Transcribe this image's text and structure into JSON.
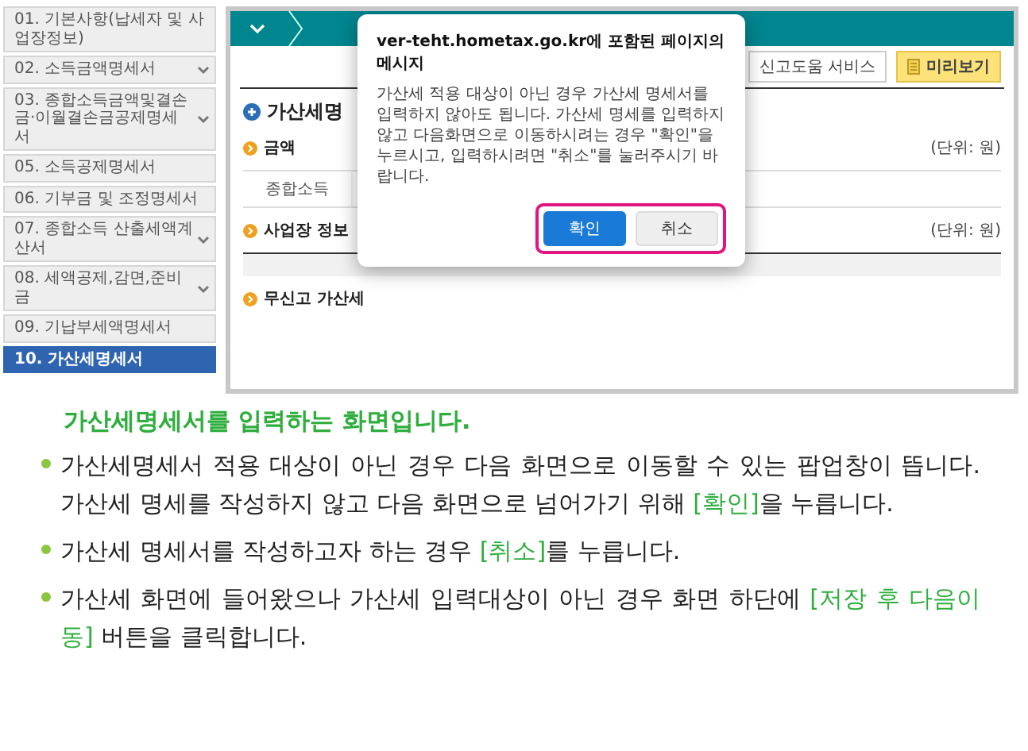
{
  "sidebar": {
    "items": [
      {
        "label": "01. 기본사항(납세자 및 사업장정보)",
        "expandable": false,
        "selected": false
      },
      {
        "label": "02. 소득금액명세서",
        "expandable": true,
        "selected": false
      },
      {
        "label": "03. 종합소득금액및결손금·이월결손금공제명세서",
        "expandable": true,
        "selected": false
      },
      {
        "label": "05. 소득공제명세서",
        "expandable": false,
        "selected": false
      },
      {
        "label": "06. 기부금 및 조정명세서",
        "expandable": false,
        "selected": false
      },
      {
        "label": "07. 종합소득 산출세액계산서",
        "expandable": true,
        "selected": false
      },
      {
        "label": "08. 세액공제,감면,준비금",
        "expandable": true,
        "selected": false
      },
      {
        "label": "09. 기납부세액명세서",
        "expandable": false,
        "selected": false
      },
      {
        "label": "10. 가산세명세서",
        "expandable": false,
        "selected": true
      }
    ]
  },
  "form": {
    "toolbar": {
      "buttons": [
        {
          "label": "신고도움 서비스",
          "kind": "plain"
        },
        {
          "label": "미리보기",
          "kind": "preview"
        }
      ]
    },
    "section_title": "가산세명",
    "subsections": [
      {
        "title": "금액",
        "unit": "(단위: 원)",
        "table": {
          "kind": "row",
          "cells": [
            "종합소득"
          ]
        }
      },
      {
        "title": "사업장 정보",
        "unit": "(단위: 원)",
        "table": {
          "kind": "header"
        }
      },
      {
        "title": "무신고 가산세"
      }
    ]
  },
  "dialog": {
    "title": "ver-teht.hometax.go.kr에 포함된 페이지의 메시지",
    "message": "가산세 적용 대상이 아닌 경우 가산세 명세서를 입력하지 않아도 됩니다. 가산세 명세를 입력하지 않고 다음화면으로 이동하시려는 경우 \"확인\"을 누르시고, 입력하시려면 \"취소\"를 눌러주시기 바랍니다.",
    "buttons": [
      {
        "label": "확인",
        "primary": true
      },
      {
        "label": "취소",
        "primary": false
      }
    ]
  },
  "caption": {
    "title": "가산세명세서를 입력하는 화면입니다.",
    "bullets": [
      "가산세명세서 적용 대상이 아닌 경우 다음 화면으로 이동할 수 있는 팝업창이 뜹니다. 가산세 명세를 작성하지 않고 다음 화면으로 넘어가기 위해 **[확인]**을 누릅니다.",
      "가산세 명세서를 작성하고자 하는 경우 **[취소]**를 누릅니다.",
      "가산세 화면에 들어왔으나 가산세 입력대상이 아닌 경우 화면 하단에 **[저장 후 다음이동]** 버튼을 클릭합니다."
    ]
  }
}
